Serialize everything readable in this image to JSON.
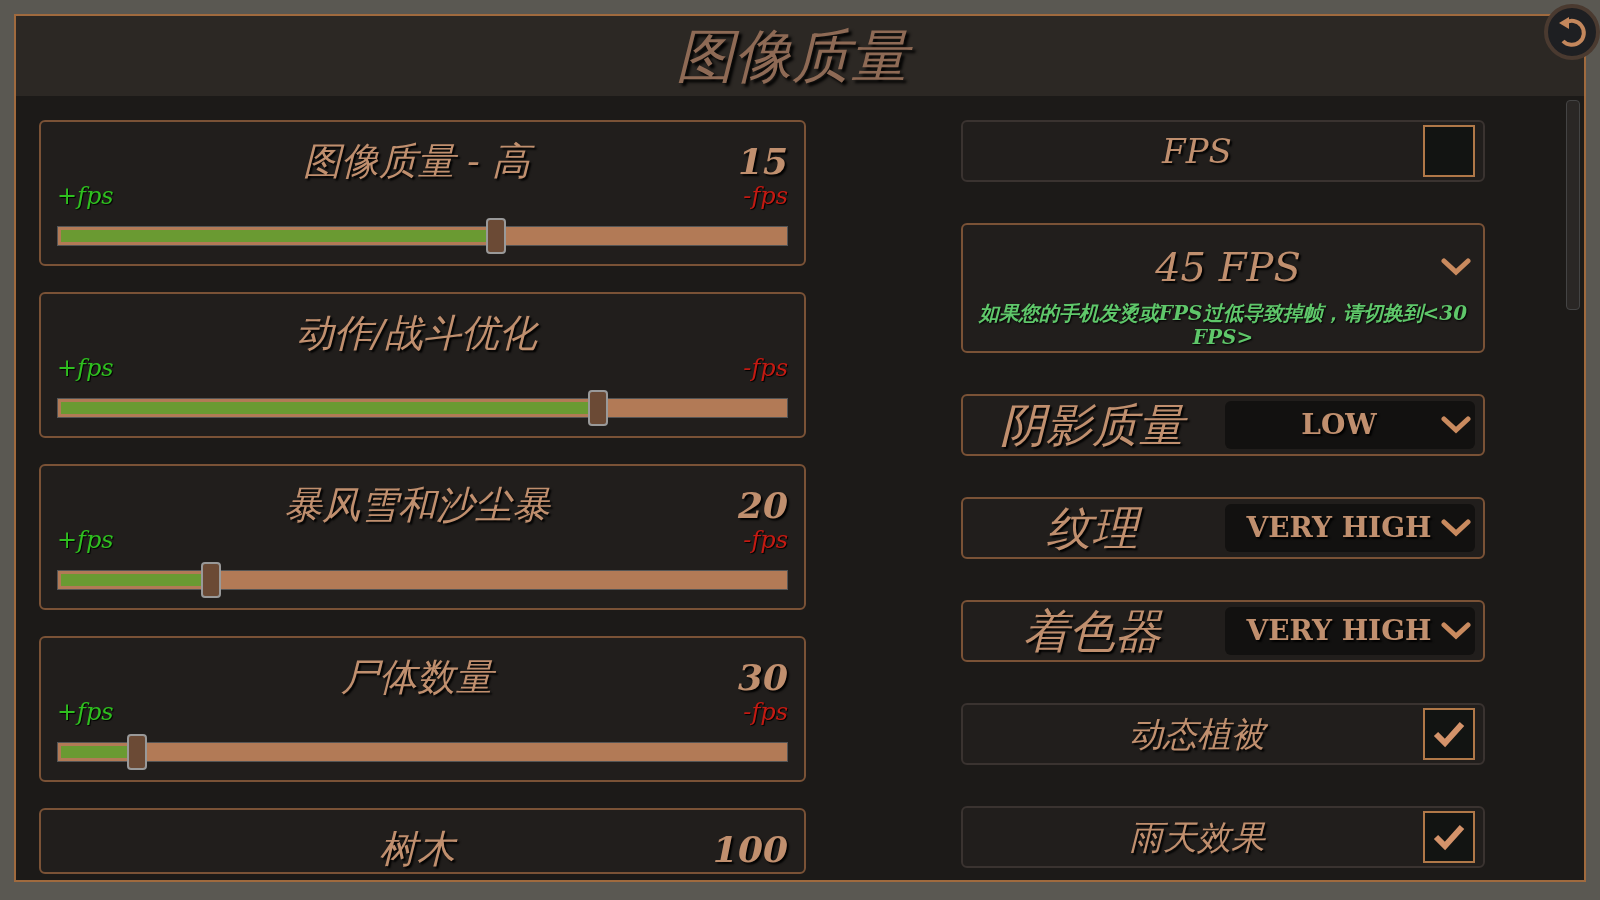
{
  "title": "图像质量",
  "sliders": [
    {
      "label": "图像质量 - 高",
      "value": "15",
      "plus": "+fps",
      "minus": "-fps",
      "level": 0.6
    },
    {
      "label": "动作/战斗优化",
      "plus": "+fps",
      "minus": "-fps",
      "level": 0.74
    },
    {
      "label": "暴风雪和沙尘暴",
      "value": "20",
      "plus": "+fps",
      "minus": "-fps",
      "level": 0.21
    },
    {
      "label": "尸体数量",
      "value": "30",
      "plus": "+fps",
      "minus": "-fps",
      "level": 0.11
    },
    {
      "label": "树木",
      "value": "100"
    }
  ],
  "options": [
    {
      "kind": "toggle",
      "label": "FPS",
      "checked": false
    },
    {
      "kind": "dropdown",
      "label": "45 FPS",
      "hint": "如果您的手机发烫或FPS过低导致掉帧，请切换到<30 FPS>"
    },
    {
      "kind": "select",
      "label": "阴影质量",
      "value": "LOW"
    },
    {
      "kind": "select",
      "label": "纹理",
      "value": "VERY HIGH"
    },
    {
      "kind": "select",
      "label": "着色器",
      "value": "VERY HIGH"
    },
    {
      "kind": "toggle",
      "label": "动态植被",
      "checked": true
    },
    {
      "kind": "toggle",
      "label": "雨天效果",
      "checked": true
    }
  ]
}
